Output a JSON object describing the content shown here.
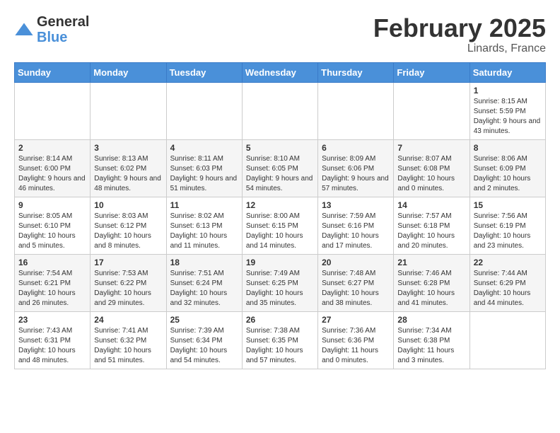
{
  "header": {
    "logo_general": "General",
    "logo_blue": "Blue",
    "month": "February 2025",
    "location": "Linards, France"
  },
  "weekdays": [
    "Sunday",
    "Monday",
    "Tuesday",
    "Wednesday",
    "Thursday",
    "Friday",
    "Saturday"
  ],
  "weeks": [
    [
      {
        "day": "",
        "info": ""
      },
      {
        "day": "",
        "info": ""
      },
      {
        "day": "",
        "info": ""
      },
      {
        "day": "",
        "info": ""
      },
      {
        "day": "",
        "info": ""
      },
      {
        "day": "",
        "info": ""
      },
      {
        "day": "1",
        "info": "Sunrise: 8:15 AM\nSunset: 5:59 PM\nDaylight: 9 hours and 43 minutes."
      }
    ],
    [
      {
        "day": "2",
        "info": "Sunrise: 8:14 AM\nSunset: 6:00 PM\nDaylight: 9 hours and 46 minutes."
      },
      {
        "day": "3",
        "info": "Sunrise: 8:13 AM\nSunset: 6:02 PM\nDaylight: 9 hours and 48 minutes."
      },
      {
        "day": "4",
        "info": "Sunrise: 8:11 AM\nSunset: 6:03 PM\nDaylight: 9 hours and 51 minutes."
      },
      {
        "day": "5",
        "info": "Sunrise: 8:10 AM\nSunset: 6:05 PM\nDaylight: 9 hours and 54 minutes."
      },
      {
        "day": "6",
        "info": "Sunrise: 8:09 AM\nSunset: 6:06 PM\nDaylight: 9 hours and 57 minutes."
      },
      {
        "day": "7",
        "info": "Sunrise: 8:07 AM\nSunset: 6:08 PM\nDaylight: 10 hours and 0 minutes."
      },
      {
        "day": "8",
        "info": "Sunrise: 8:06 AM\nSunset: 6:09 PM\nDaylight: 10 hours and 2 minutes."
      }
    ],
    [
      {
        "day": "9",
        "info": "Sunrise: 8:05 AM\nSunset: 6:10 PM\nDaylight: 10 hours and 5 minutes."
      },
      {
        "day": "10",
        "info": "Sunrise: 8:03 AM\nSunset: 6:12 PM\nDaylight: 10 hours and 8 minutes."
      },
      {
        "day": "11",
        "info": "Sunrise: 8:02 AM\nSunset: 6:13 PM\nDaylight: 10 hours and 11 minutes."
      },
      {
        "day": "12",
        "info": "Sunrise: 8:00 AM\nSunset: 6:15 PM\nDaylight: 10 hours and 14 minutes."
      },
      {
        "day": "13",
        "info": "Sunrise: 7:59 AM\nSunset: 6:16 PM\nDaylight: 10 hours and 17 minutes."
      },
      {
        "day": "14",
        "info": "Sunrise: 7:57 AM\nSunset: 6:18 PM\nDaylight: 10 hours and 20 minutes."
      },
      {
        "day": "15",
        "info": "Sunrise: 7:56 AM\nSunset: 6:19 PM\nDaylight: 10 hours and 23 minutes."
      }
    ],
    [
      {
        "day": "16",
        "info": "Sunrise: 7:54 AM\nSunset: 6:21 PM\nDaylight: 10 hours and 26 minutes."
      },
      {
        "day": "17",
        "info": "Sunrise: 7:53 AM\nSunset: 6:22 PM\nDaylight: 10 hours and 29 minutes."
      },
      {
        "day": "18",
        "info": "Sunrise: 7:51 AM\nSunset: 6:24 PM\nDaylight: 10 hours and 32 minutes."
      },
      {
        "day": "19",
        "info": "Sunrise: 7:49 AM\nSunset: 6:25 PM\nDaylight: 10 hours and 35 minutes."
      },
      {
        "day": "20",
        "info": "Sunrise: 7:48 AM\nSunset: 6:27 PM\nDaylight: 10 hours and 38 minutes."
      },
      {
        "day": "21",
        "info": "Sunrise: 7:46 AM\nSunset: 6:28 PM\nDaylight: 10 hours and 41 minutes."
      },
      {
        "day": "22",
        "info": "Sunrise: 7:44 AM\nSunset: 6:29 PM\nDaylight: 10 hours and 44 minutes."
      }
    ],
    [
      {
        "day": "23",
        "info": "Sunrise: 7:43 AM\nSunset: 6:31 PM\nDaylight: 10 hours and 48 minutes."
      },
      {
        "day": "24",
        "info": "Sunrise: 7:41 AM\nSunset: 6:32 PM\nDaylight: 10 hours and 51 minutes."
      },
      {
        "day": "25",
        "info": "Sunrise: 7:39 AM\nSunset: 6:34 PM\nDaylight: 10 hours and 54 minutes."
      },
      {
        "day": "26",
        "info": "Sunrise: 7:38 AM\nSunset: 6:35 PM\nDaylight: 10 hours and 57 minutes."
      },
      {
        "day": "27",
        "info": "Sunrise: 7:36 AM\nSunset: 6:36 PM\nDaylight: 11 hours and 0 minutes."
      },
      {
        "day": "28",
        "info": "Sunrise: 7:34 AM\nSunset: 6:38 PM\nDaylight: 11 hours and 3 minutes."
      },
      {
        "day": "",
        "info": ""
      }
    ]
  ]
}
